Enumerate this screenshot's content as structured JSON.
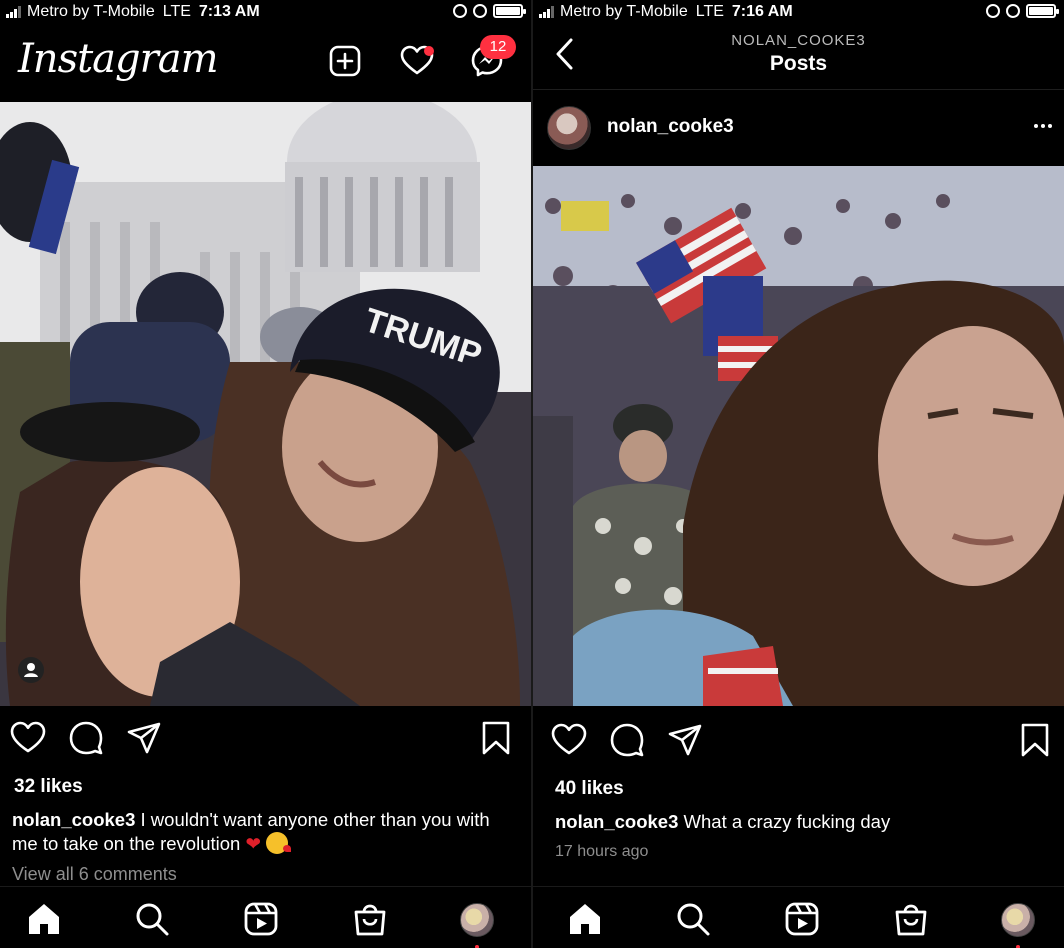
{
  "left": {
    "status": {
      "carrier": "Metro by T-Mobile",
      "network": "LTE",
      "time": "7:13 AM"
    },
    "header": {
      "logo": "Instagram",
      "messages_badge": "12"
    },
    "post": {
      "likes": "32 likes",
      "username": "nolan_cooke3",
      "caption": "I wouldn't want anyone other than you with me to take on the revolution",
      "view_comments": "View all 6 comments"
    }
  },
  "right": {
    "status": {
      "carrier": "Metro by T-Mobile",
      "network": "LTE",
      "time": "7:16 AM"
    },
    "header": {
      "profile_name": "NOLAN_COOKE3",
      "title": "Posts"
    },
    "author": {
      "username": "nolan_cooke3"
    },
    "post": {
      "likes": "40 likes",
      "username": "nolan_cooke3",
      "caption": "What a crazy fucking day",
      "time_ago": "17 hours ago"
    }
  },
  "icons": {
    "status": [
      "signal-icon",
      "alarm-icon",
      "lock-rotation-icon",
      "battery-icon"
    ],
    "header": [
      "new-post-icon",
      "activity-heart-icon",
      "messenger-icon",
      "back-chevron-icon"
    ],
    "actions": [
      "like-heart-icon",
      "comment-icon",
      "share-icon",
      "save-bookmark-icon"
    ],
    "nav": [
      "home-icon",
      "search-icon",
      "reels-icon",
      "shop-icon",
      "profile-avatar"
    ],
    "caption_emoji": [
      "red-heart-emoji",
      "face-blowing-kiss-emoji"
    ],
    "photo": [
      "tagged-user-icon"
    ]
  },
  "colors": {
    "background": "#000000",
    "text": "#ffffff",
    "muted": "#8e8e8e",
    "badge": "#ff3040"
  }
}
